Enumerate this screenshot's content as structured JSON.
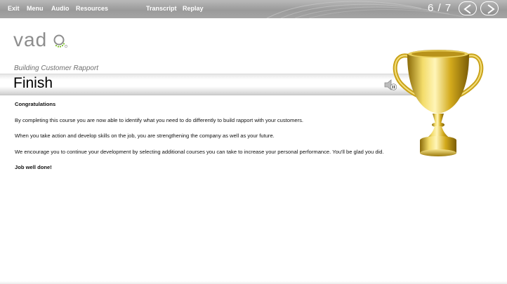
{
  "toolbar": {
    "exit_label": "Exit",
    "menu_label": "Menu",
    "audio_label": "Audio",
    "resources_label": "Resources",
    "transcript_label": "Transcript",
    "replay_label": "Replay",
    "page_counter": "6 / 7",
    "prev_icon": "chevron-left-icon",
    "next_icon": "chevron-right-icon"
  },
  "brand": {
    "logo_text": "vad",
    "course_title": "Building Customer Rapport"
  },
  "page": {
    "title": "Finish",
    "audio_icon": "speaker-pause-icon"
  },
  "content": {
    "heading": "Congratulations",
    "paragraph_1": "By completing this course you are now able to identify what you need to do differently to build rapport with your customers.",
    "paragraph_2": "When you take action and develop skills on the job, you are strengthening the company as well as your future.",
    "paragraph_3": "We encourage you to continue your development by selecting additional courses you can take to increase your personal performance. You'll be glad you did.",
    "closing": "Job well done!"
  },
  "colors": {
    "toolbar_bg": "#a4a4a4",
    "logo_gray": "#8d8d8d",
    "logo_green": "#7bbf2a",
    "trophy_gold": "#d9b21f"
  }
}
